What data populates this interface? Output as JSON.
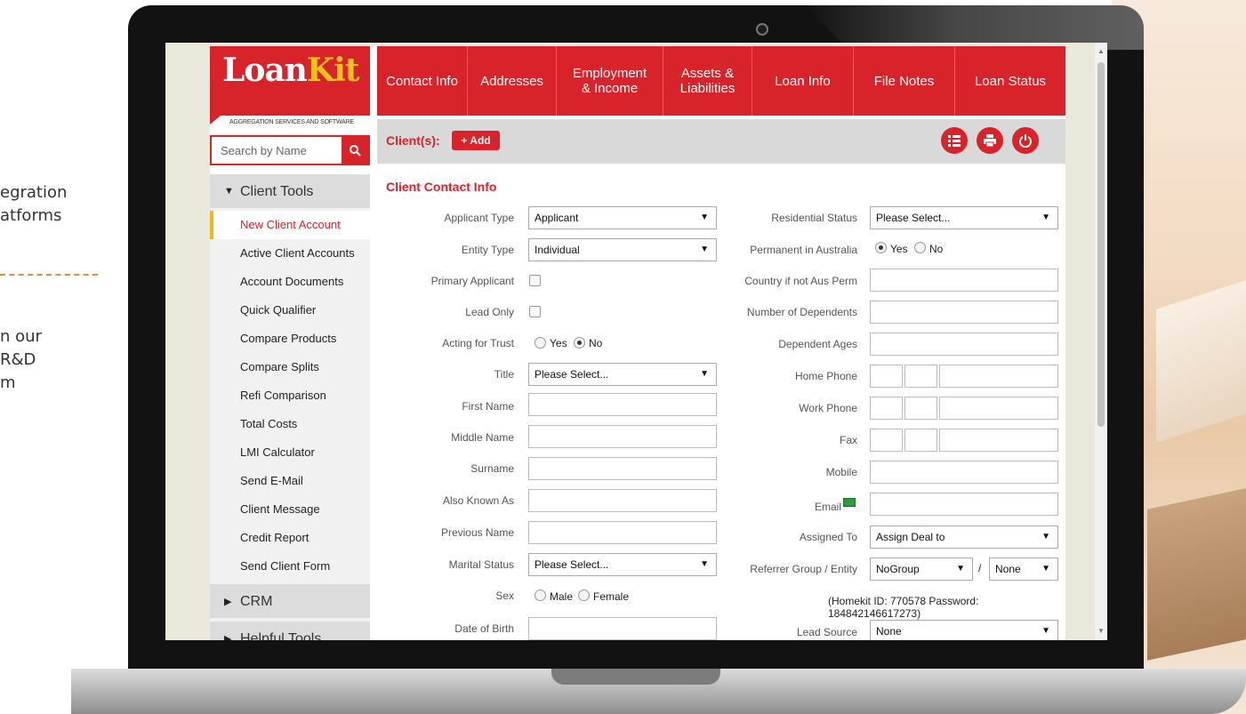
{
  "side_text": {
    "line1": "egration",
    "line2": "atforms",
    "line3": "n our",
    "line4": "R&D",
    "line5": "m"
  },
  "logo": {
    "part1": "Loan",
    "part2": "Kit",
    "subtitle": "AGGREGATION SERVICES AND SOFTWARE"
  },
  "search": {
    "placeholder": "Search by Name"
  },
  "nav": {
    "client_tools": "Client Tools",
    "items": [
      "New Client Account",
      "Active Client Accounts",
      "Account Documents",
      "Quick Qualifier",
      "Compare Products",
      "Compare Splits",
      "Refi Comparison",
      "Total Costs",
      "LMI Calculator",
      "Send E-Mail",
      "Client Message",
      "Credit Report",
      "Send Client Form"
    ],
    "crm": "CRM",
    "helpful_tools": "Helpful Tools"
  },
  "tabs": {
    "contact_info": "Contact Info",
    "addresses": "Addresses",
    "employment_1": "Employment",
    "employment_2": "& Income",
    "assets_1": "Assets &",
    "assets_2": "Liabilities",
    "loan_info": "Loan Info",
    "file_notes": "File Notes",
    "loan_status": "Loan Status"
  },
  "client_bar": {
    "label": "Client(s):",
    "add": "+ Add"
  },
  "form": {
    "title": "Client Contact Info",
    "left": {
      "applicant_type": {
        "label": "Applicant Type",
        "value": "Applicant"
      },
      "entity_type": {
        "label": "Entity Type",
        "value": "Individual"
      },
      "primary_applicant": {
        "label": "Primary Applicant",
        "checked": false
      },
      "lead_only": {
        "label": "Lead Only",
        "checked": false
      },
      "acting_for_trust": {
        "label": "Acting for Trust",
        "yes": "Yes",
        "no": "No",
        "selected": "No"
      },
      "title": {
        "label": "Title",
        "value": "Please Select..."
      },
      "first_name": {
        "label": "First Name",
        "value": ""
      },
      "middle_name": {
        "label": "Middle Name",
        "value": ""
      },
      "surname": {
        "label": "Surname",
        "value": ""
      },
      "also_known_as": {
        "label": "Also Known As",
        "value": ""
      },
      "previous_name": {
        "label": "Previous Name",
        "value": ""
      },
      "marital_status": {
        "label": "Marital Status",
        "value": "Please Select..."
      },
      "sex": {
        "label": "Sex",
        "male": "Male",
        "female": "Female"
      },
      "date_of_birth": {
        "label": "Date of Birth",
        "value": ""
      }
    },
    "right": {
      "residential_status": {
        "label": "Residential Status",
        "value": "Please Select..."
      },
      "permanent_in_australia": {
        "label": "Permanent in Australia",
        "yes": "Yes",
        "no": "No",
        "selected": "Yes"
      },
      "country_if_not_aus_perm": {
        "label": "Country if not Aus Perm"
      },
      "number_of_dependents": {
        "label": "Number of Dependents"
      },
      "dependent_ages": {
        "label": "Dependent Ages"
      },
      "home_phone": {
        "label": "Home Phone"
      },
      "work_phone": {
        "label": "Work Phone"
      },
      "fax": {
        "label": "Fax"
      },
      "mobile": {
        "label": "Mobile"
      },
      "email": {
        "label": "Email"
      },
      "assigned_to": {
        "label": "Assigned To",
        "value": "Assign Deal to"
      },
      "referrer": {
        "label": "Referrer Group / Entity",
        "group": "NoGroup",
        "separator": "/",
        "entity": "None"
      },
      "homekit_info": "(Homekit ID: 770578 Password: 184842146617273)",
      "lead_source": {
        "label": "Lead Source",
        "value": "None"
      }
    }
  },
  "colors": {
    "brand_red": "#d8232a",
    "brand_yellow": "#f2c21b",
    "active_marker": "#f2b619"
  }
}
